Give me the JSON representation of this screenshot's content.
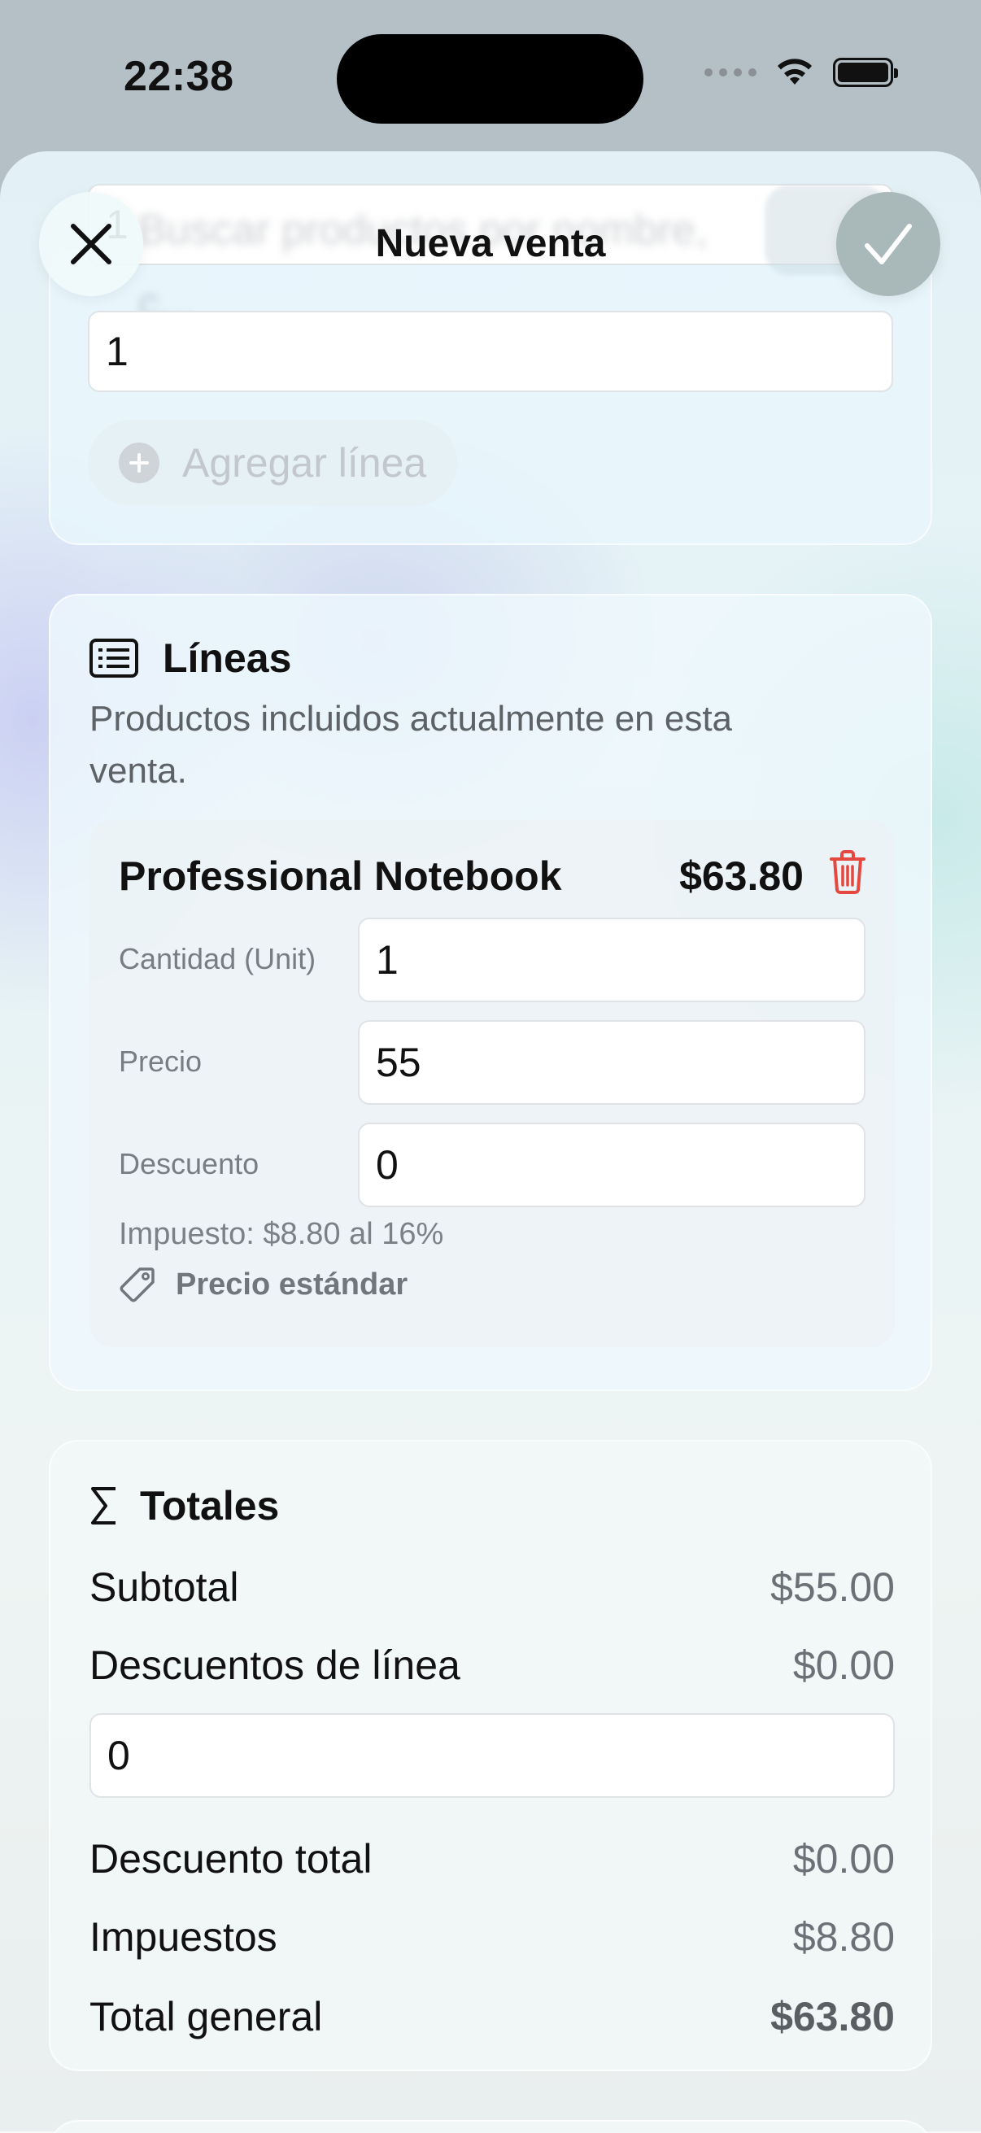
{
  "status_bar": {
    "time": "22:38"
  },
  "nav": {
    "title": "Nueva venta",
    "background_search_hint": "Buscar productos por nombre, c..."
  },
  "add_section": {
    "quantity_value": "1",
    "add_line_label": "Agregar línea"
  },
  "lines_section": {
    "title": "Líneas",
    "subtitle": "Productos incluidos actualmente en esta venta.",
    "items": [
      {
        "name": "Professional Notebook",
        "total": "$63.80",
        "quantity_label": "Cantidad (Unit)",
        "quantity_value": "1",
        "price_label": "Precio",
        "price_value": "55",
        "discount_label": "Descuento",
        "discount_value": "0",
        "tax_text": "Impuesto: $8.80 al 16%",
        "price_list": "Precio estándar"
      }
    ]
  },
  "totals_section": {
    "title": "Totales",
    "subtotal_label": "Subtotal",
    "subtotal_value": "$55.00",
    "line_discounts_label": "Descuentos de línea",
    "line_discounts_value": "$0.00",
    "global_discount_value": "0",
    "total_discount_label": "Descuento total",
    "total_discount_value": "$0.00",
    "taxes_label": "Impuestos",
    "taxes_value": "$8.80",
    "grand_total_label": "Total general",
    "grand_total_value": "$63.80"
  },
  "colors": {
    "delete_red": "#e5483f",
    "confirm_disabled": "#a9b8b8"
  },
  "icons": [
    "close-icon",
    "checkmark-icon",
    "plus-circle-icon",
    "list-icon",
    "trash-icon",
    "tag-icon",
    "sigma-icon",
    "wifi-icon",
    "battery-icon",
    "cellular-icon"
  ]
}
